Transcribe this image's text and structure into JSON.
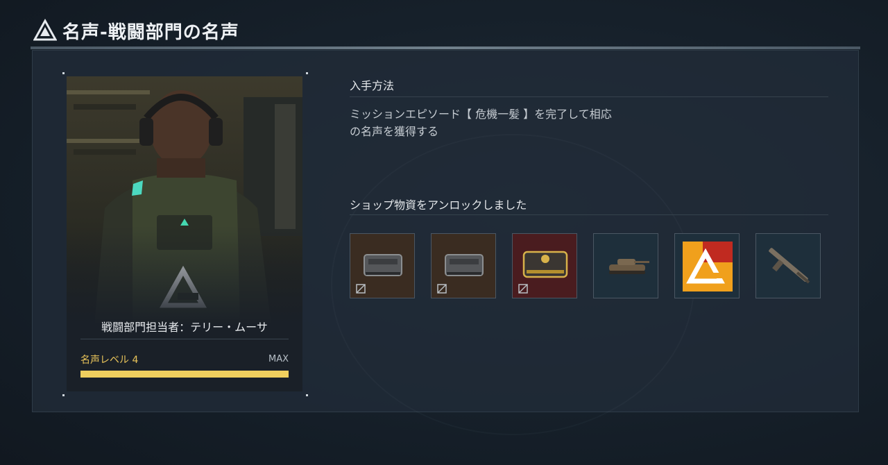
{
  "header": {
    "title": "名声-戦闘部門の名声",
    "logo_icon": "faction-a-logo-icon"
  },
  "card": {
    "name": "戦闘部門担当者：テリー・ムーサ",
    "emblem_icon": "faction-a-emblem-icon",
    "reputation_label": "名声レベル 4",
    "max_label": "MAX",
    "progress_fraction": 1.0,
    "progress_color": "#f0cf5e"
  },
  "acquire": {
    "title": "入手方法",
    "description_line1": "ミッションエピソード【 危機一髪 】を完了して相応",
    "description_line2": "の名声を獲得する"
  },
  "unlocks": {
    "title": "ショップ物資をアンロックしました",
    "items": [
      {
        "icon": "supply-crate-icon",
        "color": "#3a2c21",
        "locked_icon": "locked-icon"
      },
      {
        "icon": "supply-crate-icon",
        "color": "#3a2c21",
        "locked_icon": "locked-icon"
      },
      {
        "icon": "gold-crate-icon",
        "color": "#4a1c1f",
        "locked_icon": "locked-icon"
      },
      {
        "icon": "tank-icon",
        "color": "#1e2f3b"
      },
      {
        "icon": "faction-emblem-card-icon",
        "color": "#1e2f3b"
      },
      {
        "icon": "rifle-icon",
        "color": "#1e2f3b"
      }
    ]
  }
}
